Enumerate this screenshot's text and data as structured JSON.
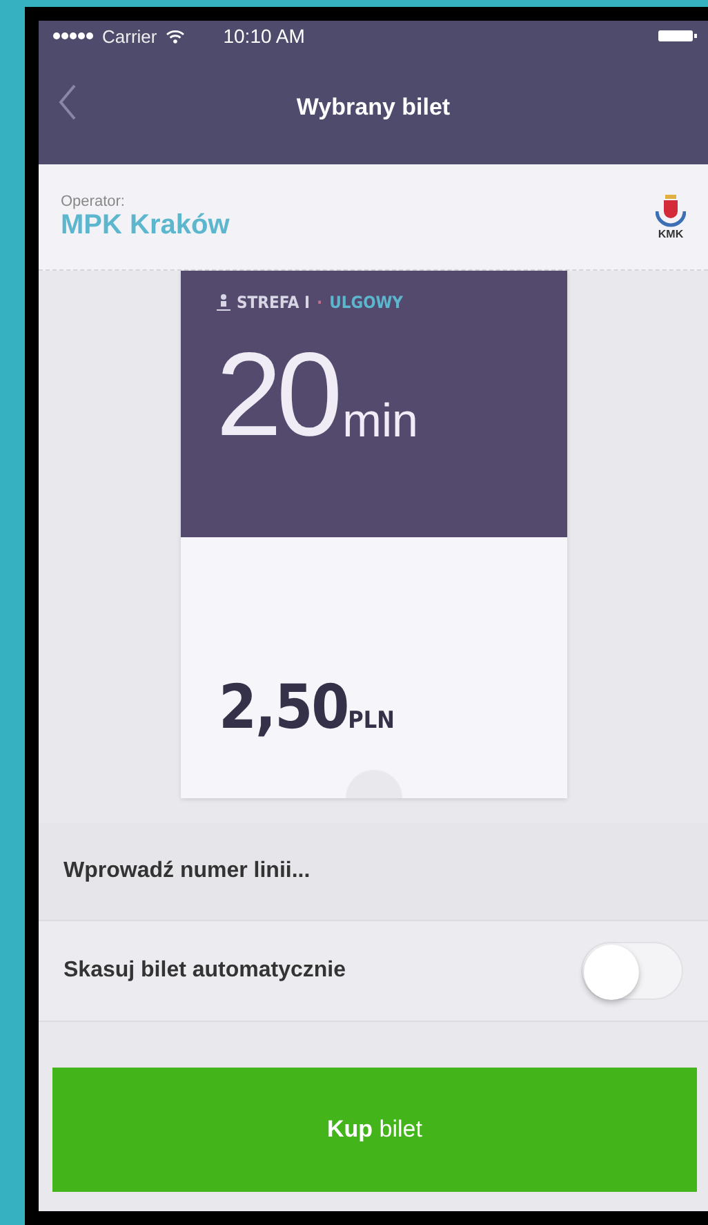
{
  "status_bar": {
    "carrier": "Carrier",
    "time": "10:10 AM"
  },
  "nav": {
    "title": "Wybrany bilet"
  },
  "operator": {
    "label": "Operator:",
    "name": "MPK Kraków",
    "logo_text": "KMK"
  },
  "ticket": {
    "zone": "STREFA I",
    "separator": "·",
    "type": "ULGOWY",
    "duration": "20",
    "duration_unit": "min",
    "price": "2,50",
    "currency": "PLN"
  },
  "line_input": {
    "placeholder": "Wprowadź numer linii..."
  },
  "auto_validate": {
    "label": "Skasuj bilet automatycznie",
    "on": false
  },
  "buy_button": {
    "label": "**Kup** bilet"
  }
}
